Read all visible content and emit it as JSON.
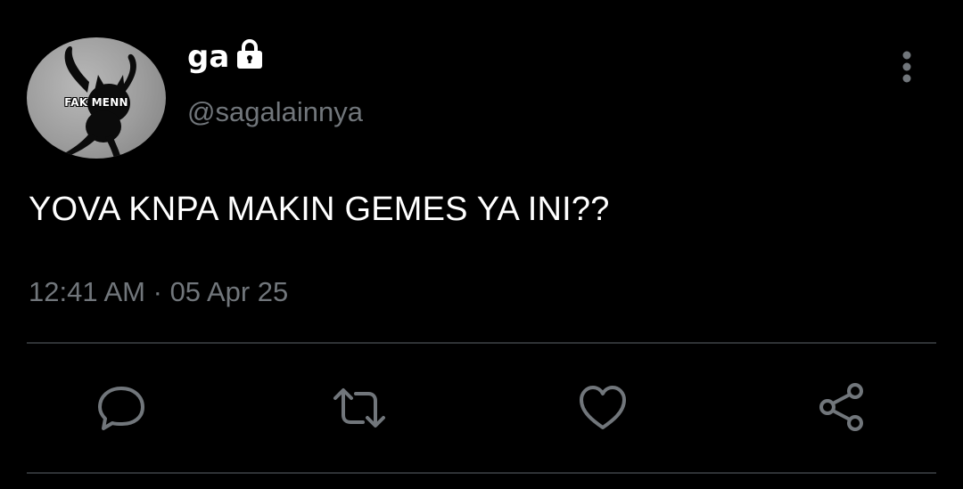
{
  "tweet": {
    "author": {
      "display_name": "ga",
      "handle": "@sagalainnya",
      "avatar_caption": "FAK MENN",
      "protected_icon": "lock-icon"
    },
    "text": "YOVA KNPA MAKIN GEMES YA INI??",
    "time": "12:41 AM",
    "separator": "·",
    "date": "05 Apr 25",
    "actions": [
      "reply-icon",
      "retweet-icon",
      "like-icon",
      "share-icon"
    ],
    "menu_icon": "more-vertical-icon"
  },
  "colors": {
    "background": "#000000",
    "primary_text": "#ffffff",
    "secondary_text": "#71767b",
    "divider": "#2f3336"
  }
}
